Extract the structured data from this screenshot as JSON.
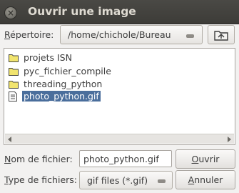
{
  "window": {
    "title": "Ouvrir une image",
    "close_glyph": "×"
  },
  "directory": {
    "label_underlined": "R",
    "label_rest": "épertoire:",
    "value": "/home/chichole/Bureau",
    "up_icon": "folder-up-icon"
  },
  "files": [
    {
      "name": "projets ISN",
      "type": "folder",
      "selected": false
    },
    {
      "name": "pyc_fichier_compile",
      "type": "folder",
      "selected": false
    },
    {
      "name": "threading_python",
      "type": "folder",
      "selected": false
    },
    {
      "name": "photo_python.gif",
      "type": "file",
      "selected": true
    }
  ],
  "filename": {
    "label_underlined": "N",
    "label_rest": "om de fichier:",
    "value": "photo_python.gif"
  },
  "filetype": {
    "label_underlined": "T",
    "label_rest": "ype de fichiers:",
    "value": "gif files (*.gif)"
  },
  "buttons": {
    "open_underlined": "O",
    "open_rest": "uvrir",
    "cancel_underlined": "A",
    "cancel_rest": "nnuler"
  },
  "colors": {
    "selection": "#4a6e9c",
    "folder": "#f1e46e",
    "titlebar": "#3d3c38"
  }
}
